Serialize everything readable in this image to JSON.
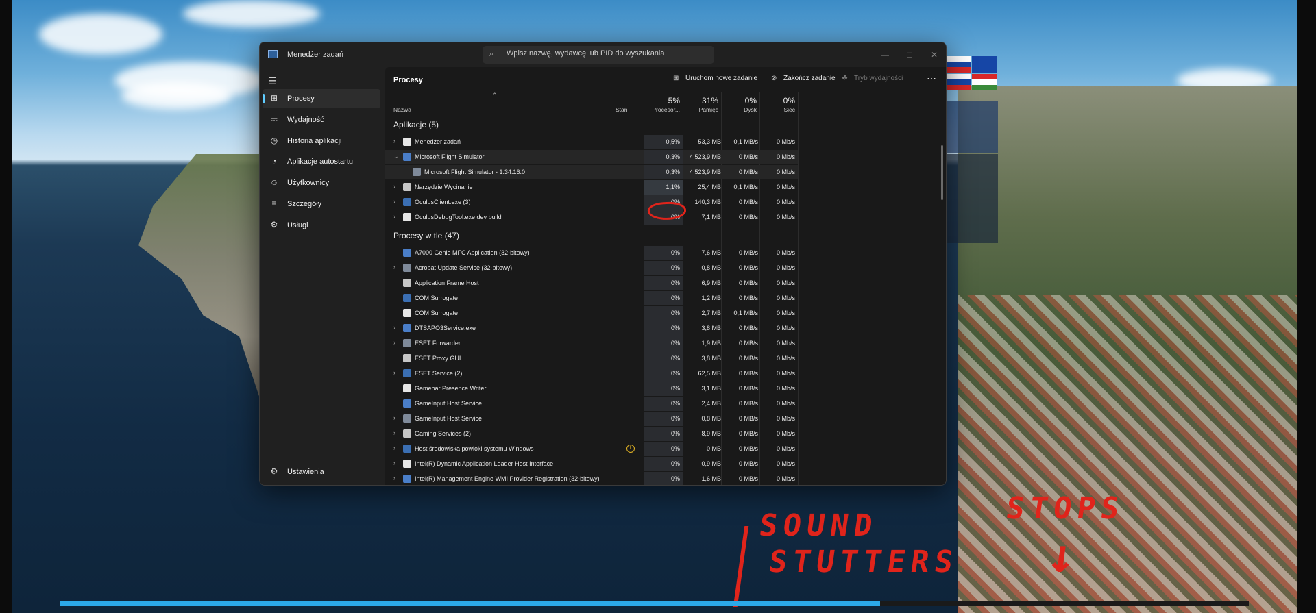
{
  "window": {
    "title": "Menedżer zadań",
    "search_placeholder": "Wpisz nazwę, wydawcę lub PID do wyszukania"
  },
  "sidebar": {
    "items": [
      {
        "label": "Procesy",
        "icon": "processes-icon"
      },
      {
        "label": "Wydajność",
        "icon": "performance-icon"
      },
      {
        "label": "Historia aplikacji",
        "icon": "app-history-icon"
      },
      {
        "label": "Aplikacje autostartu",
        "icon": "startup-apps-icon"
      },
      {
        "label": "Użytkownicy",
        "icon": "users-icon"
      },
      {
        "label": "Szczegóły",
        "icon": "details-icon"
      },
      {
        "label": "Usługi",
        "icon": "services-icon"
      }
    ],
    "settings_label": "Ustawienia"
  },
  "toolbar": {
    "page_title": "Procesy",
    "run_new_task": "Uruchom nowe zadanie",
    "end_task": "Zakończ zadanie",
    "efficiency_mode": "Tryb wydajności"
  },
  "columns": {
    "name": "Nazwa",
    "status": "Stan",
    "cpu_pct": "5%",
    "cpu": "Procesor...",
    "mem_pct": "31%",
    "mem": "Pamięć",
    "disk_pct": "0%",
    "disk": "Dysk",
    "net_pct": "0%",
    "net": "Sieć"
  },
  "groups": {
    "apps": "Aplikacje (5)",
    "background": "Procesy w tle (47)"
  },
  "apps": [
    {
      "name": "Menedżer zadań",
      "cpu": "0,5%",
      "mem": "53,3 MB",
      "disk": "0,1 MB/s",
      "net": "0 Mb/s",
      "expand": "closed"
    },
    {
      "name": "Microsoft Flight Simulator",
      "cpu": "0,3%",
      "mem": "4 523,9 MB",
      "disk": "0 MB/s",
      "net": "0 Mb/s",
      "expand": "open"
    },
    {
      "name": "Microsoft Flight Simulator - 1.34.16.0",
      "cpu": "0,3%",
      "mem": "4 523,9 MB",
      "disk": "0 MB/s",
      "net": "0 Mb/s",
      "expand": "child"
    },
    {
      "name": "Narzędzie Wycinanie",
      "cpu": "1,1%",
      "mem": "25,4 MB",
      "disk": "0,1 MB/s",
      "net": "0 Mb/s",
      "expand": "closed"
    },
    {
      "name": "OculusClient.exe (3)",
      "cpu": "0%",
      "mem": "140,3 MB",
      "disk": "0 MB/s",
      "net": "0 Mb/s",
      "expand": "closed"
    },
    {
      "name": "OculusDebugTool.exe dev build",
      "cpu": "0%",
      "mem": "7,1 MB",
      "disk": "0 MB/s",
      "net": "0 Mb/s",
      "expand": "closed"
    }
  ],
  "background": [
    {
      "name": "A7000 Genie MFC Application (32-bitowy)",
      "cpu": "0%",
      "mem": "7,6 MB",
      "disk": "0 MB/s",
      "net": "0 Mb/s",
      "expand": "none"
    },
    {
      "name": "Acrobat Update Service (32-bitowy)",
      "cpu": "0%",
      "mem": "0,8 MB",
      "disk": "0 MB/s",
      "net": "0 Mb/s",
      "expand": "closed"
    },
    {
      "name": "Application Frame Host",
      "cpu": "0%",
      "mem": "6,9 MB",
      "disk": "0 MB/s",
      "net": "0 Mb/s",
      "expand": "none"
    },
    {
      "name": "COM Surrogate",
      "cpu": "0%",
      "mem": "1,2 MB",
      "disk": "0 MB/s",
      "net": "0 Mb/s",
      "expand": "none"
    },
    {
      "name": "COM Surrogate",
      "cpu": "0%",
      "mem": "2,7 MB",
      "disk": "0,1 MB/s",
      "net": "0 Mb/s",
      "expand": "none"
    },
    {
      "name": "DTSAPO3Service.exe",
      "cpu": "0%",
      "mem": "3,8 MB",
      "disk": "0 MB/s",
      "net": "0 Mb/s",
      "expand": "closed"
    },
    {
      "name": "ESET Forwarder",
      "cpu": "0%",
      "mem": "1,9 MB",
      "disk": "0 MB/s",
      "net": "0 Mb/s",
      "expand": "closed"
    },
    {
      "name": "ESET Proxy GUI",
      "cpu": "0%",
      "mem": "3,8 MB",
      "disk": "0 MB/s",
      "net": "0 Mb/s",
      "expand": "none"
    },
    {
      "name": "ESET Service (2)",
      "cpu": "0%",
      "mem": "62,5 MB",
      "disk": "0 MB/s",
      "net": "0 Mb/s",
      "expand": "closed"
    },
    {
      "name": "Gamebar Presence Writer",
      "cpu": "0%",
      "mem": "3,1 MB",
      "disk": "0 MB/s",
      "net": "0 Mb/s",
      "expand": "none"
    },
    {
      "name": "GameInput Host Service",
      "cpu": "0%",
      "mem": "2,4 MB",
      "disk": "0 MB/s",
      "net": "0 Mb/s",
      "expand": "none"
    },
    {
      "name": "GameInput Host Service",
      "cpu": "0%",
      "mem": "0,8 MB",
      "disk": "0 MB/s",
      "net": "0 Mb/s",
      "expand": "closed"
    },
    {
      "name": "Gaming Services (2)",
      "cpu": "0%",
      "mem": "8,9 MB",
      "disk": "0 MB/s",
      "net": "0 Mb/s",
      "expand": "closed"
    },
    {
      "name": "Host środowiska powłoki systemu Windows",
      "cpu": "0%",
      "mem": "0 MB",
      "disk": "0 MB/s",
      "net": "0 Mb/s",
      "expand": "closed",
      "paused": true
    },
    {
      "name": "Intel(R) Dynamic Application Loader Host Interface",
      "cpu": "0%",
      "mem": "0,9 MB",
      "disk": "0 MB/s",
      "net": "0 Mb/s",
      "expand": "closed"
    },
    {
      "name": "Intel(R) Management Engine WMI Provider Registration (32-bitowy)",
      "cpu": "0%",
      "mem": "1,6 MB",
      "disk": "0 MB/s",
      "net": "0 Mb/s",
      "expand": "closed"
    }
  ],
  "annotations": {
    "sound_line1": "SOUND",
    "sound_line2": "STUTTERS",
    "stops": "STOPS"
  },
  "playback": {
    "progress": 0.69
  },
  "colors": {
    "accent": "#60cdff",
    "annotation_red": "#e0241b",
    "progress_blue": "#2ba8ea"
  }
}
